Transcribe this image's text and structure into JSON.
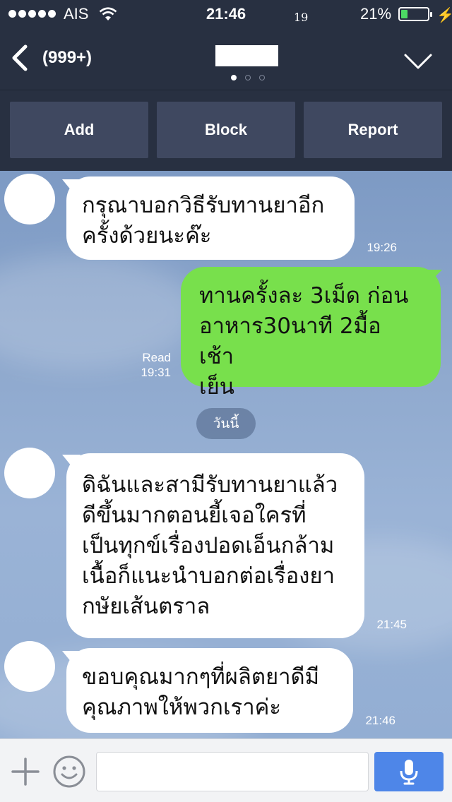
{
  "status": {
    "carrier": "AIS",
    "time": "21:46",
    "small_number": "19",
    "battery_pct": "21%",
    "battery_level": 0.21,
    "colors": {
      "battery": "#4cd964"
    }
  },
  "nav": {
    "back_icon": "chevron-left-icon",
    "unread_count": "(999+)",
    "dropdown_icon": "chevron-down-icon"
  },
  "actions": {
    "add": "Add",
    "block": "Block",
    "report": "Report"
  },
  "messages": [
    {
      "side": "left",
      "lines": [
        "กรุณาบอกวิธีรับทานยาอีก",
        "ครั้งด้วยนะค๊ะ"
      ],
      "time": "19:26"
    },
    {
      "side": "right",
      "lines": [
        "ทานครั้งละ 3เม็ด ก่อน",
        "อาหาร30นาที 2มื้อ เช้า",
        "เย็น"
      ],
      "read": "Read",
      "time": "19:31"
    },
    {
      "side": "left",
      "lines": [
        "ดิฉันและสามีรับทานยาแล้ว",
        "ดีขึ้นมากตอนยี้เจอใครที่",
        "เป็นทุกข์เรื่องปอดเอ็นกล้าม",
        "เนื้อก็แนะนำบอกต่อเรื่องยา",
        "กษัยเส้นตราล"
      ],
      "time": "21:45"
    },
    {
      "side": "left",
      "lines": [
        "ขอบคุณมากๆที่ผลิตยาดีมี",
        "คุณภาพให้พวกเราค่ะ"
      ],
      "time": "21:46"
    }
  ],
  "date_divider": "วันนี้",
  "input": {
    "plus_icon": "plus-icon",
    "sticker_icon": "smiley-icon",
    "placeholder": "",
    "mic_icon": "microphone-icon",
    "colors": {
      "mic_button": "#4e86e8",
      "own_bubble": "#78e04c"
    }
  }
}
